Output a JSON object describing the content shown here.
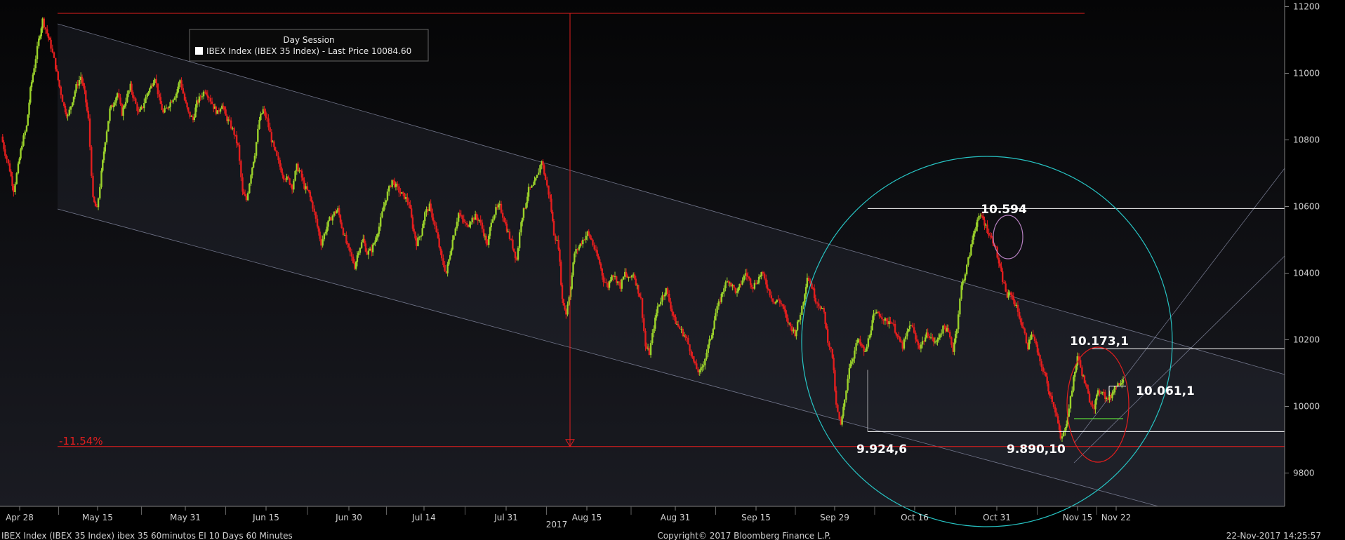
{
  "chart_data": {
    "type": "candlestick",
    "title": "Day Session",
    "legend": {
      "placement": "top-left",
      "entries": [
        "IBEX Index (IBEX 35 Index) - Last Price 10084.60"
      ]
    },
    "y_axis": {
      "position": "right",
      "ylim": [
        9700,
        11220
      ],
      "ticks": [
        9800,
        10000,
        10200,
        10400,
        10600,
        10800,
        11000,
        11200
      ]
    },
    "x_axis": {
      "tick_labels": [
        "Apr 28",
        "May 15",
        "May 31",
        "Jun 15",
        "Jun 30",
        "Jul 14",
        "Jul 31",
        "Aug 15",
        "Aug 31",
        "Sep 15",
        "Sep 29",
        "Oct 16",
        "Oct 31",
        "Nov 15",
        "Nov 22"
      ],
      "year_label": "2017"
    },
    "series": [
      {
        "name": "IBEX Index (IBEX 35 Index) - Last Price",
        "last": 10084.6,
        "up_color": "#9bd22b",
        "down_color": "#e31e1e",
        "path": [
          [
            0,
            10810
          ],
          [
            0.4,
            10760
          ],
          [
            0.9,
            10710
          ],
          [
            1.3,
            10650
          ],
          [
            1.8,
            10720
          ],
          [
            2.2,
            10790
          ],
          [
            2.7,
            10840
          ],
          [
            3.1,
            10950
          ],
          [
            3.5,
            11020
          ],
          [
            4.0,
            11100
          ],
          [
            4.4,
            11160
          ],
          [
            4.9,
            11120
          ],
          [
            5.3,
            11080
          ],
          [
            5.8,
            11020
          ],
          [
            6.2,
            10960
          ],
          [
            6.7,
            10900
          ],
          [
            7.1,
            10870
          ],
          [
            7.6,
            10920
          ],
          [
            8.0,
            10960
          ],
          [
            8.5,
            10990
          ],
          [
            8.9,
            10940
          ],
          [
            9.3,
            10860
          ],
          [
            9.8,
            10620
          ],
          [
            10.2,
            10590
          ],
          [
            10.7,
            10700
          ],
          [
            11.1,
            10800
          ],
          [
            11.6,
            10890
          ],
          [
            12.0,
            10910
          ],
          [
            12.4,
            10940
          ],
          [
            12.9,
            10880
          ],
          [
            13.3,
            10920
          ],
          [
            13.8,
            10960
          ],
          [
            14.2,
            10920
          ],
          [
            14.7,
            10880
          ],
          [
            15.1,
            10900
          ],
          [
            15.6,
            10940
          ],
          [
            16.0,
            10960
          ],
          [
            16.4,
            10990
          ],
          [
            16.9,
            10920
          ],
          [
            17.3,
            10880
          ],
          [
            17.8,
            10900
          ],
          [
            18.2,
            10920
          ],
          [
            18.7,
            10940
          ],
          [
            19.1,
            10980
          ],
          [
            19.6,
            10920
          ],
          [
            20.0,
            10880
          ],
          [
            20.5,
            10860
          ],
          [
            20.9,
            10910
          ],
          [
            21.3,
            10930
          ],
          [
            21.8,
            10950
          ],
          [
            22.2,
            10930
          ],
          [
            22.7,
            10900
          ],
          [
            23.1,
            10880
          ],
          [
            23.6,
            10910
          ],
          [
            24.0,
            10870
          ],
          [
            24.4,
            10850
          ],
          [
            24.9,
            10820
          ],
          [
            25.3,
            10780
          ],
          [
            25.8,
            10640
          ],
          [
            26.2,
            10620
          ],
          [
            26.7,
            10700
          ],
          [
            27.1,
            10760
          ],
          [
            27.6,
            10860
          ],
          [
            28.0,
            10890
          ],
          [
            28.4,
            10860
          ],
          [
            28.9,
            10800
          ],
          [
            29.3,
            10760
          ],
          [
            29.8,
            10720
          ],
          [
            30.2,
            10690
          ],
          [
            30.7,
            10680
          ],
          [
            31.1,
            10660
          ],
          [
            31.6,
            10720
          ],
          [
            32.0,
            10700
          ],
          [
            32.4,
            10660
          ],
          [
            32.9,
            10640
          ],
          [
            33.3,
            10600
          ],
          [
            33.8,
            10540
          ],
          [
            34.2,
            10490
          ],
          [
            34.7,
            10530
          ],
          [
            35.1,
            10560
          ],
          [
            35.6,
            10580
          ],
          [
            36.0,
            10590
          ],
          [
            36.4,
            10540
          ],
          [
            36.9,
            10490
          ],
          [
            37.3,
            10460
          ],
          [
            37.8,
            10420
          ],
          [
            38.2,
            10470
          ],
          [
            38.7,
            10500
          ],
          [
            39.1,
            10460
          ],
          [
            39.6,
            10470
          ],
          [
            40.0,
            10500
          ],
          [
            40.4,
            10540
          ],
          [
            40.9,
            10600
          ],
          [
            41.3,
            10640
          ],
          [
            41.8,
            10680
          ],
          [
            42.2,
            10660
          ],
          [
            42.7,
            10640
          ],
          [
            43.1,
            10630
          ],
          [
            43.6,
            10610
          ],
          [
            44.0,
            10540
          ],
          [
            44.4,
            10490
          ],
          [
            44.9,
            10520
          ],
          [
            45.3,
            10580
          ],
          [
            45.8,
            10600
          ],
          [
            46.2,
            10560
          ],
          [
            46.7,
            10500
          ],
          [
            47.1,
            10440
          ],
          [
            47.6,
            10400
          ],
          [
            48.0,
            10460
          ],
          [
            48.4,
            10520
          ],
          [
            48.9,
            10580
          ],
          [
            49.3,
            10560
          ],
          [
            49.8,
            10540
          ],
          [
            50.2,
            10560
          ],
          [
            50.7,
            10570
          ],
          [
            51.1,
            10560
          ],
          [
            51.6,
            10520
          ],
          [
            52.0,
            10480
          ],
          [
            52.4,
            10560
          ],
          [
            52.9,
            10590
          ],
          [
            53.3,
            10600
          ],
          [
            53.8,
            10560
          ],
          [
            54.2,
            10520
          ],
          [
            54.7,
            10480
          ],
          [
            55.1,
            10440
          ],
          [
            55.6,
            10560
          ],
          [
            56.0,
            10600
          ],
          [
            56.4,
            10650
          ],
          [
            56.9,
            10660
          ],
          [
            57.3,
            10690
          ],
          [
            57.8,
            10740
          ],
          [
            58.2,
            10680
          ],
          [
            58.7,
            10620
          ],
          [
            59.1,
            10520
          ],
          [
            59.6,
            10480
          ],
          [
            60.0,
            10320
          ],
          [
            60.4,
            10280
          ],
          [
            60.9,
            10360
          ],
          [
            61.3,
            10460
          ],
          [
            61.8,
            10480
          ],
          [
            62.2,
            10500
          ],
          [
            62.7,
            10520
          ],
          [
            63.1,
            10500
          ],
          [
            63.6,
            10460
          ],
          [
            64.0,
            10430
          ],
          [
            64.4,
            10380
          ],
          [
            64.9,
            10360
          ],
          [
            65.3,
            10400
          ],
          [
            65.8,
            10380
          ],
          [
            66.2,
            10360
          ],
          [
            66.7,
            10400
          ],
          [
            67.1,
            10380
          ],
          [
            67.6,
            10400
          ],
          [
            68.0,
            10360
          ],
          [
            68.4,
            10320
          ],
          [
            68.9,
            10180
          ],
          [
            69.3,
            10160
          ],
          [
            69.8,
            10240
          ],
          [
            70.2,
            10300
          ],
          [
            70.7,
            10330
          ],
          [
            71.1,
            10350
          ],
          [
            71.6,
            10300
          ],
          [
            72.0,
            10260
          ],
          [
            72.4,
            10240
          ],
          [
            72.9,
            10220
          ],
          [
            73.3,
            10200
          ],
          [
            73.8,
            10160
          ],
          [
            74.2,
            10120
          ],
          [
            74.7,
            10100
          ],
          [
            75.1,
            10130
          ],
          [
            75.6,
            10180
          ],
          [
            76.0,
            10220
          ],
          [
            76.4,
            10280
          ],
          [
            76.9,
            10320
          ],
          [
            77.3,
            10360
          ],
          [
            77.8,
            10380
          ],
          [
            78.2,
            10360
          ],
          [
            78.7,
            10340
          ],
          [
            79.1,
            10370
          ],
          [
            79.6,
            10400
          ],
          [
            80.0,
            10380
          ],
          [
            80.4,
            10360
          ],
          [
            80.9,
            10380
          ],
          [
            81.3,
            10400
          ],
          [
            81.8,
            10370
          ],
          [
            82.2,
            10340
          ],
          [
            82.7,
            10310
          ],
          [
            83.1,
            10320
          ],
          [
            83.6,
            10300
          ],
          [
            84.0,
            10260
          ],
          [
            84.4,
            10240
          ],
          [
            84.9,
            10220
          ],
          [
            85.3,
            10260
          ],
          [
            85.8,
            10320
          ],
          [
            86.2,
            10390
          ],
          [
            86.7,
            10360
          ],
          [
            87.1,
            10320
          ],
          [
            87.6,
            10300
          ],
          [
            88.0,
            10280
          ],
          [
            88.4,
            10200
          ],
          [
            88.9,
            10150
          ],
          [
            89.3,
            10000
          ],
          [
            89.8,
            9940
          ],
          [
            90.2,
            10020
          ],
          [
            90.7,
            10120
          ],
          [
            91.1,
            10150
          ],
          [
            91.6,
            10200
          ],
          [
            92.0,
            10180
          ],
          [
            92.4,
            10160
          ],
          [
            92.9,
            10220
          ],
          [
            93.3,
            10270
          ],
          [
            93.8,
            10280
          ],
          [
            94.2,
            10270
          ],
          [
            94.7,
            10250
          ],
          [
            95.1,
            10260
          ],
          [
            95.6,
            10230
          ],
          [
            96.0,
            10200
          ],
          [
            96.4,
            10180
          ],
          [
            96.9,
            10220
          ],
          [
            97.3,
            10250
          ],
          [
            97.8,
            10200
          ],
          [
            98.2,
            10180
          ],
          [
            98.7,
            10200
          ],
          [
            99.1,
            10220
          ],
          [
            99.6,
            10200
          ],
          [
            100.0,
            10190
          ],
          [
            100.4,
            10220
          ],
          [
            100.9,
            10240
          ],
          [
            101.3,
            10220
          ],
          [
            101.8,
            10170
          ],
          [
            102.2,
            10240
          ],
          [
            102.7,
            10360
          ],
          [
            103.1,
            10400
          ],
          [
            103.6,
            10460
          ],
          [
            104.0,
            10520
          ],
          [
            104.4,
            10560
          ],
          [
            104.9,
            10570
          ],
          [
            105.3,
            10540
          ],
          [
            105.8,
            10510
          ],
          [
            106.2,
            10490
          ],
          [
            106.7,
            10430
          ],
          [
            107.1,
            10380
          ],
          [
            107.6,
            10330
          ],
          [
            108.0,
            10340
          ],
          [
            108.4,
            10310
          ],
          [
            108.9,
            10270
          ],
          [
            109.3,
            10230
          ],
          [
            109.8,
            10180
          ],
          [
            110.2,
            10220
          ],
          [
            110.7,
            10180
          ],
          [
            111.1,
            10130
          ],
          [
            111.6,
            10100
          ],
          [
            112.0,
            10050
          ],
          [
            112.4,
            10020
          ],
          [
            112.9,
            9970
          ],
          [
            113.3,
            9900
          ],
          [
            113.8,
            9930
          ],
          [
            114.2,
            10000
          ],
          [
            114.7,
            10080
          ],
          [
            115.1,
            10150
          ],
          [
            115.6,
            10100
          ],
          [
            116.0,
            10060
          ],
          [
            116.4,
            10020
          ],
          [
            116.9,
            10000
          ],
          [
            117.3,
            10040
          ],
          [
            117.8,
            10050
          ],
          [
            118.2,
            10020
          ],
          [
            118.7,
            10030
          ],
          [
            119.1,
            10060
          ],
          [
            119.6,
            10070
          ],
          [
            120.0,
            10085
          ]
        ]
      }
    ],
    "annotations": [
      {
        "text": "10.594"
      },
      {
        "text": "10.173,1"
      },
      {
        "text": "10.061,1"
      },
      {
        "text": "9.924,6"
      },
      {
        "text": "9.890,10"
      },
      {
        "text": "-11.54%"
      }
    ],
    "horizontal_levels": [
      11180,
      10594,
      10173.1,
      10061.1,
      9924.6,
      9890
    ],
    "colors": {
      "background": "#000000",
      "candle_up": "#9bd22b",
      "candle_down": "#e31e1e",
      "level_line": "#ffffff",
      "range_marker": "#e31e1e",
      "channel": "#8a8fa8",
      "big_circle": "#27c4c4",
      "peak_ellipse": "#b580c0",
      "low_ellipse": "#e31e1e"
    }
  },
  "footer": {
    "left": "IBEX Index (IBEX 35 Index) ibex 35 60minutos EI 10 Days 60 Minutes",
    "center": "Copyright© 2017 Bloomberg Finance L.P.",
    "right": "22-Nov-2017 14:25:57"
  }
}
